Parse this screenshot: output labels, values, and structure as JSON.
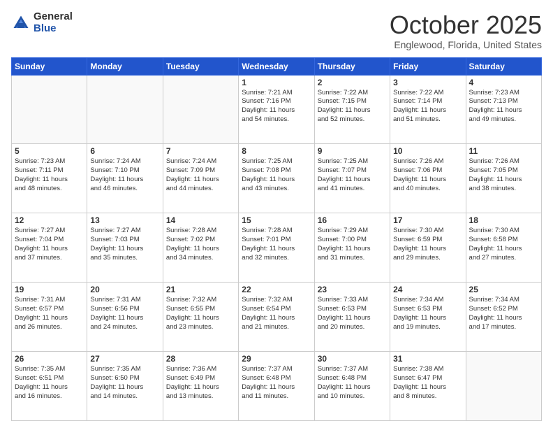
{
  "header": {
    "logo": {
      "general": "General",
      "blue": "Blue"
    },
    "title": "October 2025",
    "location": "Englewood, Florida, United States"
  },
  "calendar": {
    "days_of_week": [
      "Sunday",
      "Monday",
      "Tuesday",
      "Wednesday",
      "Thursday",
      "Friday",
      "Saturday"
    ],
    "weeks": [
      [
        {
          "day": "",
          "info": ""
        },
        {
          "day": "",
          "info": ""
        },
        {
          "day": "",
          "info": ""
        },
        {
          "day": "1",
          "info": "Sunrise: 7:21 AM\nSunset: 7:16 PM\nDaylight: 11 hours\nand 54 minutes."
        },
        {
          "day": "2",
          "info": "Sunrise: 7:22 AM\nSunset: 7:15 PM\nDaylight: 11 hours\nand 52 minutes."
        },
        {
          "day": "3",
          "info": "Sunrise: 7:22 AM\nSunset: 7:14 PM\nDaylight: 11 hours\nand 51 minutes."
        },
        {
          "day": "4",
          "info": "Sunrise: 7:23 AM\nSunset: 7:13 PM\nDaylight: 11 hours\nand 49 minutes."
        }
      ],
      [
        {
          "day": "5",
          "info": "Sunrise: 7:23 AM\nSunset: 7:11 PM\nDaylight: 11 hours\nand 48 minutes."
        },
        {
          "day": "6",
          "info": "Sunrise: 7:24 AM\nSunset: 7:10 PM\nDaylight: 11 hours\nand 46 minutes."
        },
        {
          "day": "7",
          "info": "Sunrise: 7:24 AM\nSunset: 7:09 PM\nDaylight: 11 hours\nand 44 minutes."
        },
        {
          "day": "8",
          "info": "Sunrise: 7:25 AM\nSunset: 7:08 PM\nDaylight: 11 hours\nand 43 minutes."
        },
        {
          "day": "9",
          "info": "Sunrise: 7:25 AM\nSunset: 7:07 PM\nDaylight: 11 hours\nand 41 minutes."
        },
        {
          "day": "10",
          "info": "Sunrise: 7:26 AM\nSunset: 7:06 PM\nDaylight: 11 hours\nand 40 minutes."
        },
        {
          "day": "11",
          "info": "Sunrise: 7:26 AM\nSunset: 7:05 PM\nDaylight: 11 hours\nand 38 minutes."
        }
      ],
      [
        {
          "day": "12",
          "info": "Sunrise: 7:27 AM\nSunset: 7:04 PM\nDaylight: 11 hours\nand 37 minutes."
        },
        {
          "day": "13",
          "info": "Sunrise: 7:27 AM\nSunset: 7:03 PM\nDaylight: 11 hours\nand 35 minutes."
        },
        {
          "day": "14",
          "info": "Sunrise: 7:28 AM\nSunset: 7:02 PM\nDaylight: 11 hours\nand 34 minutes."
        },
        {
          "day": "15",
          "info": "Sunrise: 7:28 AM\nSunset: 7:01 PM\nDaylight: 11 hours\nand 32 minutes."
        },
        {
          "day": "16",
          "info": "Sunrise: 7:29 AM\nSunset: 7:00 PM\nDaylight: 11 hours\nand 31 minutes."
        },
        {
          "day": "17",
          "info": "Sunrise: 7:30 AM\nSunset: 6:59 PM\nDaylight: 11 hours\nand 29 minutes."
        },
        {
          "day": "18",
          "info": "Sunrise: 7:30 AM\nSunset: 6:58 PM\nDaylight: 11 hours\nand 27 minutes."
        }
      ],
      [
        {
          "day": "19",
          "info": "Sunrise: 7:31 AM\nSunset: 6:57 PM\nDaylight: 11 hours\nand 26 minutes."
        },
        {
          "day": "20",
          "info": "Sunrise: 7:31 AM\nSunset: 6:56 PM\nDaylight: 11 hours\nand 24 minutes."
        },
        {
          "day": "21",
          "info": "Sunrise: 7:32 AM\nSunset: 6:55 PM\nDaylight: 11 hours\nand 23 minutes."
        },
        {
          "day": "22",
          "info": "Sunrise: 7:32 AM\nSunset: 6:54 PM\nDaylight: 11 hours\nand 21 minutes."
        },
        {
          "day": "23",
          "info": "Sunrise: 7:33 AM\nSunset: 6:53 PM\nDaylight: 11 hours\nand 20 minutes."
        },
        {
          "day": "24",
          "info": "Sunrise: 7:34 AM\nSunset: 6:53 PM\nDaylight: 11 hours\nand 19 minutes."
        },
        {
          "day": "25",
          "info": "Sunrise: 7:34 AM\nSunset: 6:52 PM\nDaylight: 11 hours\nand 17 minutes."
        }
      ],
      [
        {
          "day": "26",
          "info": "Sunrise: 7:35 AM\nSunset: 6:51 PM\nDaylight: 11 hours\nand 16 minutes."
        },
        {
          "day": "27",
          "info": "Sunrise: 7:35 AM\nSunset: 6:50 PM\nDaylight: 11 hours\nand 14 minutes."
        },
        {
          "day": "28",
          "info": "Sunrise: 7:36 AM\nSunset: 6:49 PM\nDaylight: 11 hours\nand 13 minutes."
        },
        {
          "day": "29",
          "info": "Sunrise: 7:37 AM\nSunset: 6:48 PM\nDaylight: 11 hours\nand 11 minutes."
        },
        {
          "day": "30",
          "info": "Sunrise: 7:37 AM\nSunset: 6:48 PM\nDaylight: 11 hours\nand 10 minutes."
        },
        {
          "day": "31",
          "info": "Sunrise: 7:38 AM\nSunset: 6:47 PM\nDaylight: 11 hours\nand 8 minutes."
        },
        {
          "day": "",
          "info": ""
        }
      ]
    ]
  }
}
